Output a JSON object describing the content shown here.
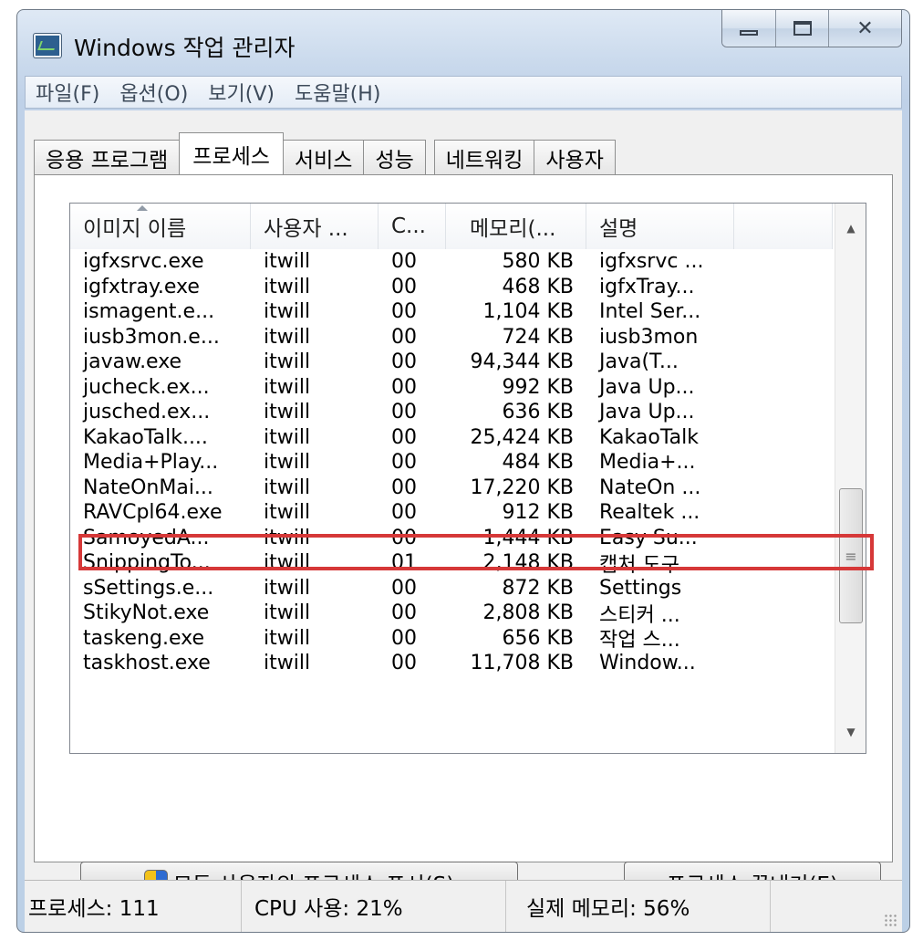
{
  "window": {
    "title": "Windows 작업 관리자"
  },
  "menu": [
    "파일(F)",
    "옵션(O)",
    "보기(V)",
    "도움말(H)"
  ],
  "tabs": [
    {
      "label": "응용 프로그램",
      "active": false
    },
    {
      "label": "프로세스",
      "active": true
    },
    {
      "label": "서비스",
      "active": false
    },
    {
      "label": "성능",
      "active": false
    },
    {
      "label": "네트워킹",
      "active": false
    },
    {
      "label": "사용자",
      "active": false
    }
  ],
  "columns": [
    "이미지 이름",
    "사용자 ...",
    "C...",
    "메모리(...",
    "설명"
  ],
  "processes": [
    [
      "igfxsrvc.exe",
      "itwill",
      "00",
      "580 KB",
      "igfxsrvc ..."
    ],
    [
      "igfxtray.exe",
      "itwill",
      "00",
      "468 KB",
      "igfxTray..."
    ],
    [
      "ismagent.e...",
      "itwill",
      "00",
      "1,104 KB",
      "Intel Ser..."
    ],
    [
      "iusb3mon.e...",
      "itwill",
      "00",
      "724 KB",
      "iusb3mon"
    ],
    [
      "javaw.exe",
      "itwill",
      "00",
      "94,344 KB",
      "Java(T..."
    ],
    [
      "jucheck.ex...",
      "itwill",
      "00",
      "992 KB",
      "Java Up..."
    ],
    [
      "jusched.ex...",
      "itwill",
      "00",
      "636 KB",
      "Java Up..."
    ],
    [
      "KakaoTalk....",
      "itwill",
      "00",
      "25,424 KB",
      "KakaoTalk"
    ],
    [
      "Media+Play...",
      "itwill",
      "00",
      "484 KB",
      "Media+..."
    ],
    [
      "NateOnMai...",
      "itwill",
      "00",
      "17,220 KB",
      "NateOn ..."
    ],
    [
      "RAVCpl64.exe",
      "itwill",
      "00",
      "912 KB",
      "Realtek ..."
    ],
    [
      "SamoyedA...",
      "itwill",
      "00",
      "1,444 KB",
      "Easy Su..."
    ],
    [
      "SnippingTo...",
      "itwill",
      "01",
      "2,148 KB",
      "캡처 도구"
    ],
    [
      "sSettings.e...",
      "itwill",
      "00",
      "872 KB",
      "Settings"
    ],
    [
      "StikyNot.exe",
      "itwill",
      "00",
      "2,808 KB",
      "스티커 ..."
    ],
    [
      "taskeng.exe",
      "itwill",
      "00",
      "656 KB",
      "작업 스..."
    ],
    [
      "taskhost.exe",
      "itwill",
      "00",
      "11,708 KB",
      "Window..."
    ]
  ],
  "selected_row": 4,
  "buttons": {
    "show_all": "모든 사용자의 프로세스 표시(S)",
    "end_process": "프로세스 끝내기(E)"
  },
  "status": {
    "processes": "프로세스: 111",
    "cpu": "CPU 사용: 21%",
    "memory": "실제 메모리: 56%"
  },
  "colors": {
    "highlight": "#d63838",
    "frame": "#bcd0e6"
  },
  "icons": [
    "task-manager-icon",
    "minimize-icon",
    "maximize-icon",
    "close-icon",
    "uac-shield-icon",
    "sort-ascending-icon",
    "scroll-up-icon",
    "scroll-down-icon",
    "resize-grip-icon"
  ]
}
